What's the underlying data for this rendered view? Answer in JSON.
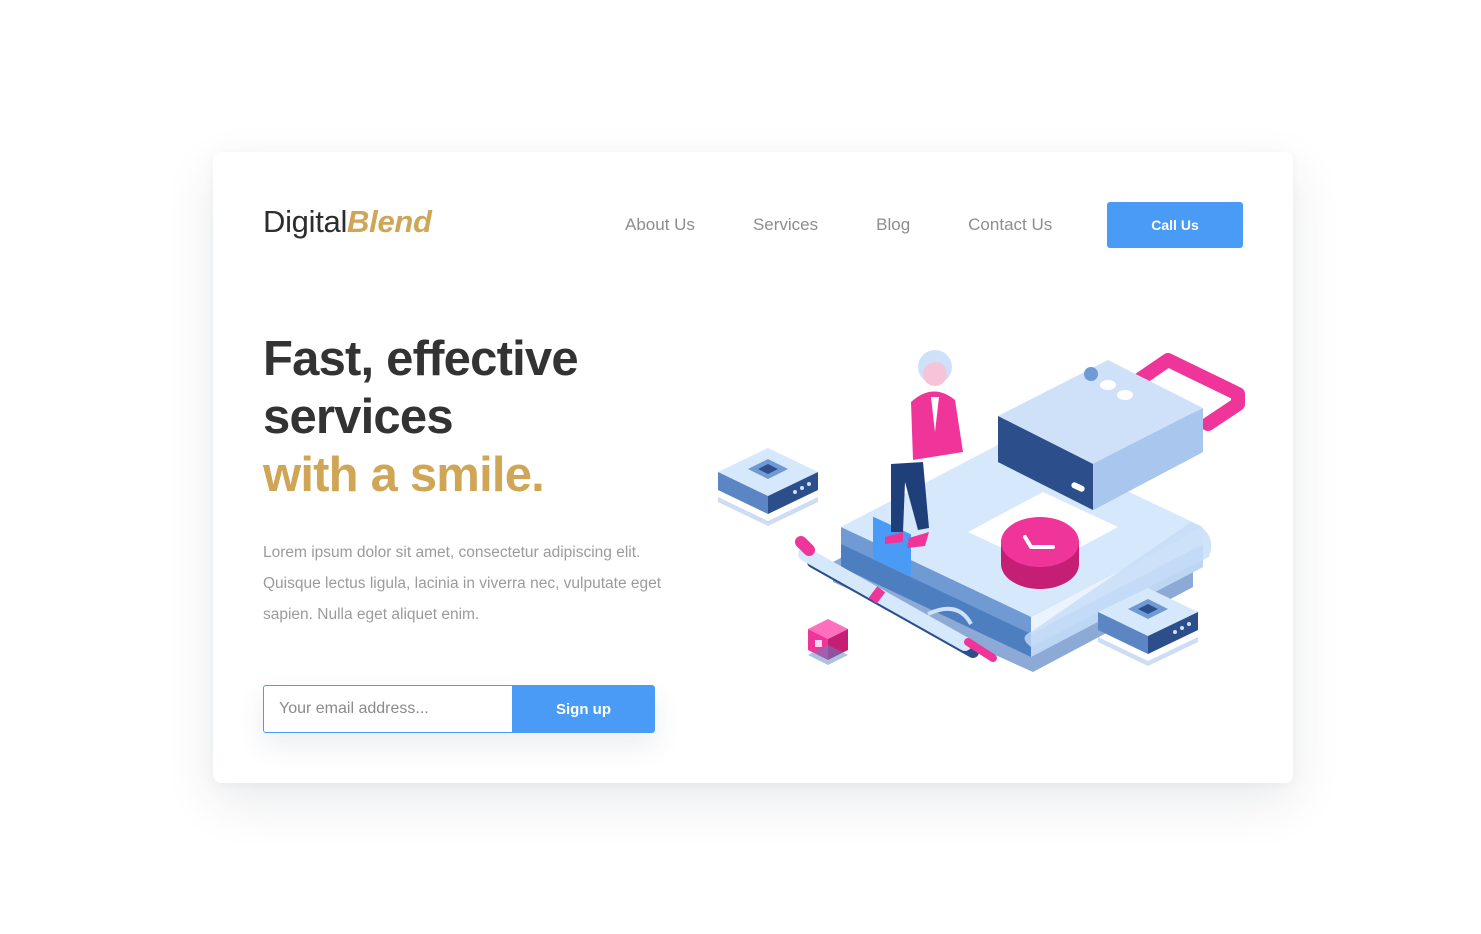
{
  "brand": {
    "name_regular": "Digital",
    "name_accent": "Blend",
    "accent_color": "#cfa655"
  },
  "nav": {
    "items": [
      {
        "label": "About Us"
      },
      {
        "label": "Services"
      },
      {
        "label": "Blog"
      },
      {
        "label": "Contact Us"
      }
    ],
    "cta_label": "Call Us"
  },
  "hero": {
    "headline_line1": "Fast, effective",
    "headline_line2": "services",
    "headline_accent": "with a smile.",
    "description": "Lorem ipsum dolor sit amet, consectetur adipiscing elit. Quisque lectus ligula, lacinia in viverra nec, vulputate eget sapien. Nulla eget aliquet enim."
  },
  "signup_form": {
    "email_placeholder": "Your email address...",
    "email_value": "",
    "button_label": "Sign up"
  },
  "colors": {
    "primary": "#4a9bf5",
    "accent": "#cfa655",
    "heading": "#333333",
    "body_text": "#9b9b9b",
    "illustration_pink": "#f0359a",
    "illustration_light_blue": "#d6e8fb",
    "illustration_mid_blue": "#5b86c3",
    "illustration_dark_blue": "#2c4f8c"
  },
  "illustration": {
    "icon_name": "security-illustration-icon"
  }
}
